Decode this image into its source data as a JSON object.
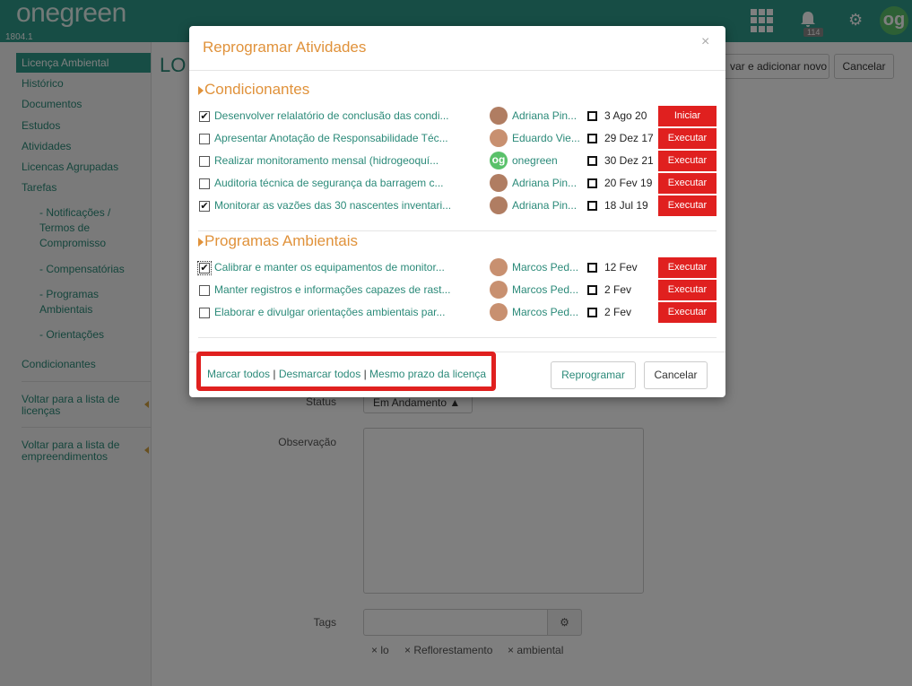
{
  "app": {
    "logo": "onegreen",
    "version": "1804.1",
    "notification_count": "114",
    "avatar_text": "og"
  },
  "sidebar": {
    "active": "Licença Ambiental",
    "items": [
      "Histórico",
      "Documentos",
      "Estudos",
      "Atividades",
      "Licencas Agrupadas",
      "Tarefas"
    ],
    "subitems": [
      "- Notificações / Termos de Compromisso",
      "- Compensatórias",
      "- Programas Ambientais",
      "- Orientações"
    ],
    "condicionantes": "Condicionantes",
    "back_licencas": "Voltar para a lista de licenças",
    "back_empreendimentos": "Voltar para a lista de empreendimentos"
  },
  "background": {
    "page_title": "LO",
    "save_add_label": "var e adicionar novo",
    "cancel_label": "Cancelar",
    "status_label": "Status",
    "status_value": "Em Andamento",
    "obs_label": "Observação",
    "tags_label": "Tags",
    "tags": [
      "lo",
      "Reflorestamento",
      "ambiental"
    ]
  },
  "modal": {
    "title": "Reprogramar Atividades",
    "close": "×",
    "sections": [
      {
        "title": "Condicionantes",
        "rows": [
          {
            "checked": true,
            "activity": "Desenvolver relalatório de conclusão das condi...",
            "person": "Adriana Pin...",
            "avatar": "f",
            "date": "3 Ago 20",
            "action": "Iniciar"
          },
          {
            "checked": false,
            "activity": "Apresentar Anotação de Responsabilidade Téc...",
            "person": "Eduardo Vie...",
            "avatar": "m",
            "date": "29 Dez 17",
            "action": "Executar"
          },
          {
            "checked": false,
            "activity": "Realizar monitoramento mensal (hidrogeoquí...",
            "person": "onegreen",
            "avatar": "og",
            "date": "30 Dez 21",
            "action": "Executar"
          },
          {
            "checked": false,
            "activity": "Auditoria técnica de segurança da barragem c...",
            "person": "Adriana Pin...",
            "avatar": "f",
            "date": "20 Fev 19",
            "action": "Executar"
          },
          {
            "checked": true,
            "activity": "Monitorar as vazões das 30 nascentes inventari...",
            "person": "Adriana Pin...",
            "avatar": "f",
            "date": "18 Jul 19",
            "action": "Executar"
          }
        ]
      },
      {
        "title": "Programas Ambientais",
        "rows": [
          {
            "checked": true,
            "activity": "Calibrar e manter os equipamentos de monitor...",
            "person": "Marcos Ped...",
            "avatar": "m",
            "date": "12 Fev",
            "action": "Executar"
          },
          {
            "checked": false,
            "activity": "Manter registros e informações capazes de rast...",
            "person": "Marcos Ped...",
            "avatar": "m",
            "date": "2 Fev",
            "action": "Executar"
          },
          {
            "checked": false,
            "activity": "Elaborar e divulgar orientações ambientais par...",
            "person": "Marcos Ped...",
            "avatar": "m",
            "date": "2 Fev",
            "action": "Executar"
          }
        ]
      }
    ],
    "footer": {
      "mark_all": "Marcar todos",
      "unmark_all": "Desmarcar todos",
      "same_deadline": "Mesmo prazo da licença",
      "separator": "|",
      "reprogram": "Reprogramar",
      "cancel": "Cancelar"
    }
  },
  "colors": {
    "brand": "#2e9b8a",
    "accent": "#e0923b",
    "danger": "#e0201f"
  }
}
